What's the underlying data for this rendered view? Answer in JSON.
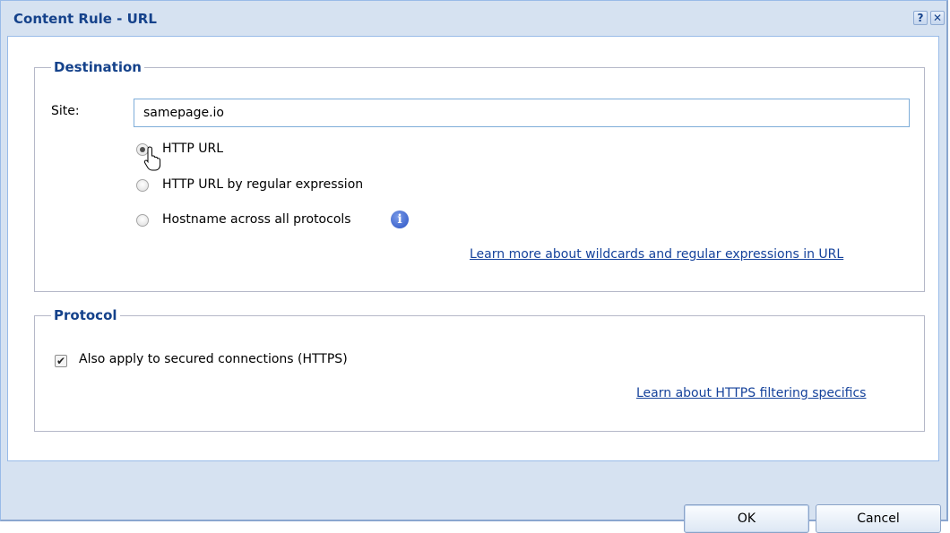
{
  "window": {
    "title": "Content Rule - URL",
    "help_icon": "help-icon",
    "close_icon": "close-icon"
  },
  "destination": {
    "legend": "Destination",
    "site_label": "Site:",
    "site_value": "samepage.io",
    "options": [
      {
        "label": "HTTP URL",
        "checked": true
      },
      {
        "label": "HTTP URL by regular expression",
        "checked": false
      },
      {
        "label": "Hostname across all protocols",
        "checked": false
      }
    ],
    "info_icon": "info-icon",
    "learn_more_link": "Learn more about wildcards and regular expressions in URL"
  },
  "protocol": {
    "legend": "Protocol",
    "https_label": "Also apply to secured connections (HTTPS)",
    "https_checked": true,
    "learn_link": "Learn about HTTPS filtering specifics"
  },
  "buttons": {
    "ok": "OK",
    "cancel": "Cancel"
  },
  "colors": {
    "title": "#15428b",
    "frame": "#d6e2f1",
    "link": "#15429b"
  }
}
